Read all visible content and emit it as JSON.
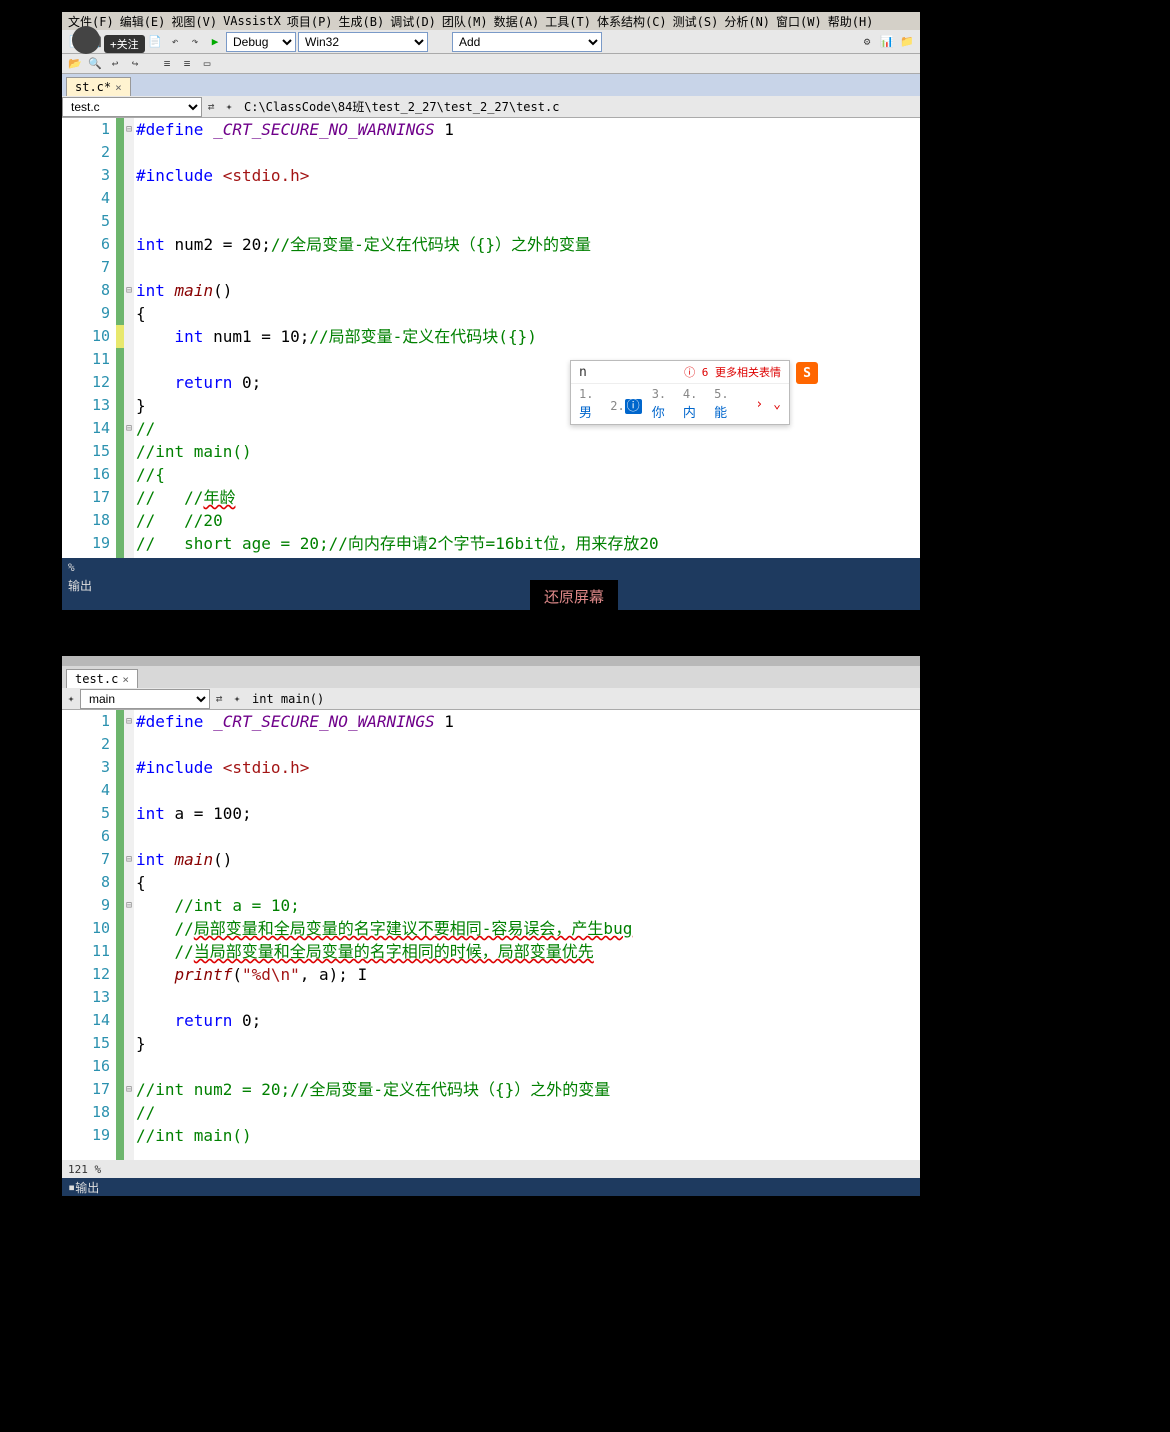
{
  "menus": [
    "文件(F)",
    "编辑(E)",
    "视图(V)",
    "VAssistX",
    "项目(P)",
    "生成(B)",
    "调试(D)",
    "团队(M)",
    "数据(A)",
    "工具(T)",
    "体系结构(C)",
    "测试(S)",
    "分析(N)",
    "窗口(W)",
    "帮助(H)"
  ],
  "toolbar": {
    "config": "Debug",
    "platform": "Win32",
    "find": "Add"
  },
  "follow": "+关注",
  "tab": {
    "name": "st.c*",
    "close": "×"
  },
  "nav1": {
    "scope": "test.c",
    "path": "C:\\ClassCode\\84班\\test_2_27\\test_2_27\\test.c"
  },
  "pane1_lines": [
    {
      "n": 1,
      "fold": "⊟",
      "html": "<span class='kw'>#define</span> <span class='mac'>_CRT_SECURE_NO_WARNINGS</span> 1"
    },
    {
      "n": 2,
      "html": ""
    },
    {
      "n": 3,
      "html": "<span class='kw'>#include</span> <span class='str'>&lt;stdio.h&gt;</span>"
    },
    {
      "n": 4,
      "html": ""
    },
    {
      "n": 5,
      "html": ""
    },
    {
      "n": 6,
      "html": "<span class='ty'>int</span> num2 = 20;<span class='cmt'>//全局变量-定义在代码块（{}）之外的变量</span>"
    },
    {
      "n": 7,
      "html": ""
    },
    {
      "n": 8,
      "fold": "⊟",
      "html": "<span class='ty'>int</span> <span class='fn'>main</span>()"
    },
    {
      "n": 9,
      "html": "{"
    },
    {
      "n": 10,
      "mod": true,
      "html": "    <span class='ty'>int</span> num1 = 10;<span class='cmt'>//局部变量-定义在代码块({})</span>"
    },
    {
      "n": 11,
      "html": ""
    },
    {
      "n": 12,
      "html": "    <span class='kw'>return</span> 0;"
    },
    {
      "n": 13,
      "html": "}"
    },
    {
      "n": 14,
      "fold": "⊟",
      "html": "<span class='cmt'>//</span>"
    },
    {
      "n": 15,
      "html": "<span class='cmt'>//int main()</span>"
    },
    {
      "n": 16,
      "html": "<span class='cmt'>//{</span>"
    },
    {
      "n": 17,
      "html": "<span class='cmt'>//   //<span class='underline'>年龄</span></span>"
    },
    {
      "n": 18,
      "html": "<span class='cmt'>//   //20</span>"
    },
    {
      "n": 19,
      "html": "<span class='cmt'>//   short age = 20;//向内存申请2个字节=16bit位，用来存放20</span>"
    }
  ],
  "status1": "%   ",
  "output_label": "输出",
  "restore": "还原屏幕",
  "ime": {
    "input": "n",
    "hint": "ⓘ 6 更多相关表情",
    "opts": [
      {
        "n": "1.",
        "w": "男"
      },
      {
        "n": "2.",
        "w": "ⓘ",
        "info": true
      },
      {
        "n": "3.",
        "w": "你"
      },
      {
        "n": "4.",
        "w": "内"
      },
      {
        "n": "5.",
        "w": "能"
      }
    ],
    "logo": "S"
  },
  "tab2": {
    "name": "test.c",
    "close": "×"
  },
  "nav2": {
    "scope": "main",
    "func": "int main()"
  },
  "pane2_lines": [
    {
      "n": 1,
      "fold": "⊟",
      "html": "<span class='kw'>#define</span> <span class='mac'>_CRT_SECURE_NO_WARNINGS</span> 1"
    },
    {
      "n": 2,
      "html": ""
    },
    {
      "n": 3,
      "html": "<span class='kw'>#include</span> <span class='str'>&lt;stdio.h&gt;</span>"
    },
    {
      "n": 4,
      "html": ""
    },
    {
      "n": 5,
      "html": "<span class='ty'>int</span> a = 100;"
    },
    {
      "n": 6,
      "html": ""
    },
    {
      "n": 7,
      "fold": "⊟",
      "html": "<span class='ty'>int</span> <span class='fn'>main</span>()"
    },
    {
      "n": 8,
      "html": "{"
    },
    {
      "n": 9,
      "fold": "⊟",
      "html": "    <span class='cmt'>//int a = 10;</span>"
    },
    {
      "n": 10,
      "html": "    <span class='cmt'>//<span class='underline'>局部变量和全局变量的名字建议不要相同-容易误会，产生bug</span></span>"
    },
    {
      "n": 11,
      "html": "    <span class='cmt'>//<span class='underline'>当局部变量和全局变量的名字相同的时候，局部变量优先</span></span>"
    },
    {
      "n": 12,
      "html": "    <span class='fn'>printf</span>(<span class='str'>\"%d\\n\"</span>, a); I"
    },
    {
      "n": 13,
      "html": ""
    },
    {
      "n": 14,
      "html": "    <span class='kw'>return</span> 0;"
    },
    {
      "n": 15,
      "html": "}"
    },
    {
      "n": 16,
      "html": ""
    },
    {
      "n": 17,
      "fold": "⊟",
      "html": "<span class='cmt'>//int num2 = 20;//全局变量-定义在代码块（{}）之外的变量</span>"
    },
    {
      "n": 18,
      "html": "<span class='cmt'>//</span>"
    },
    {
      "n": 19,
      "html": "<span class='cmt'>//int main()</span>"
    }
  ],
  "zoom": "121 %  ",
  "output2": "输出"
}
